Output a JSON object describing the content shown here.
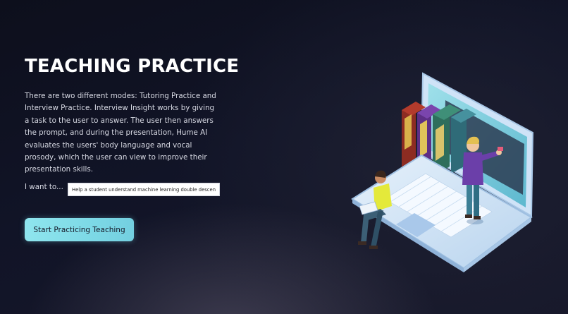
{
  "hero": {
    "title": "TEACHING PRACTICE",
    "description": "There are two different modes: Tutoring Practice and Interview Practice. Interview Insight works by giving a task to the user to answer. The user then answers the prompt, and during the presentation, Hume AI evaluates the users' body language and vocal prosody, which the user can view to improve their presentation skills.",
    "want_label": "I want to...",
    "prompt_value": "Help a student understand machine learning double descent.",
    "start_button": "Start Practicing Teaching"
  },
  "colors": {
    "background": "#111427",
    "button": "#86dfea",
    "title": "#ffffff"
  },
  "illustration": {
    "icon": "laptop-books-students-illustration"
  }
}
